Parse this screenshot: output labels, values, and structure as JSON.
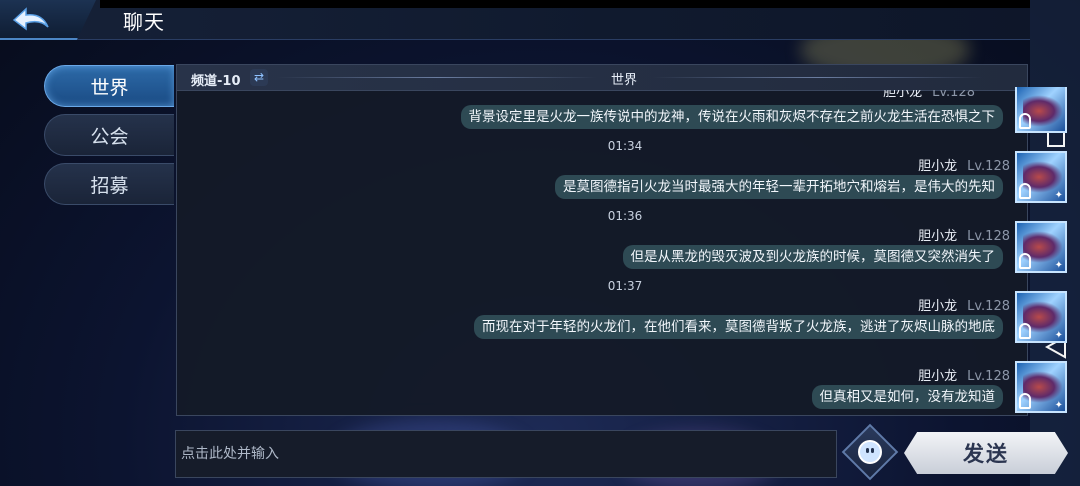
{
  "header": {
    "back_label": "",
    "title": "聊天"
  },
  "tabs": [
    {
      "label": "世界",
      "active": true
    },
    {
      "label": "公会",
      "active": false
    },
    {
      "label": "招募",
      "active": false
    }
  ],
  "chat": {
    "channel": "频道-10",
    "title": "世界",
    "partial_name": "胆小龙",
    "messages": [
      {
        "text": "背景设定里是火龙一族传说中的龙神，传说在火雨和灰烬不存在之前火龙生活在恐惧之下"
      },
      {
        "time": "01:34",
        "name": "胆小龙",
        "level": "Lv.128",
        "text": "是莫图德指引火龙当时最强大的年轻一辈开拓地穴和熔岩，是伟大的先知"
      },
      {
        "time": "01:36",
        "name": "胆小龙",
        "level": "Lv.128",
        "text": "但是从黑龙的毁灭波及到火龙族的时候，莫图德又突然消失了"
      },
      {
        "time": "01:37",
        "name": "胆小龙",
        "level": "Lv.128",
        "text": "而现在对于年轻的火龙们，在他们看来，莫图德背叛了火龙族，逃进了灰烬山脉的地底"
      },
      {
        "name": "胆小龙",
        "level": "Lv.128",
        "text": "但真相又是如何，没有龙知道"
      }
    ]
  },
  "input": {
    "placeholder": "点击此处并输入"
  },
  "send_label": "发送",
  "icons": {
    "back": "back-arrow-icon",
    "swap": "swap-channel-icon",
    "emoji": "emoji-icon",
    "system_nav": [
      "square-icon",
      "circle-icon",
      "triangle-back-icon"
    ]
  }
}
